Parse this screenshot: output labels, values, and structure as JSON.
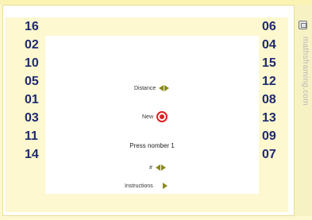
{
  "left_numbers": [
    "16",
    "02",
    "10",
    "05",
    "01",
    "03",
    "11",
    "14"
  ],
  "right_numbers": [
    "06",
    "04",
    "15",
    "12",
    "08",
    "13",
    "09",
    "07"
  ],
  "controls": {
    "distance_label": "Distance",
    "new_label": "New",
    "prompt": "Press nomber 1",
    "size_label": "#",
    "instructions_label": "Instructions"
  },
  "side": {
    "site_text": "mathsframing.com",
    "icon": "restore-window-icon"
  },
  "colors": {
    "number_color": "#1f2a6e",
    "band_color": "#fdf8cf",
    "arrow_color": "#8a8a1a",
    "target_color": "#e02020"
  }
}
